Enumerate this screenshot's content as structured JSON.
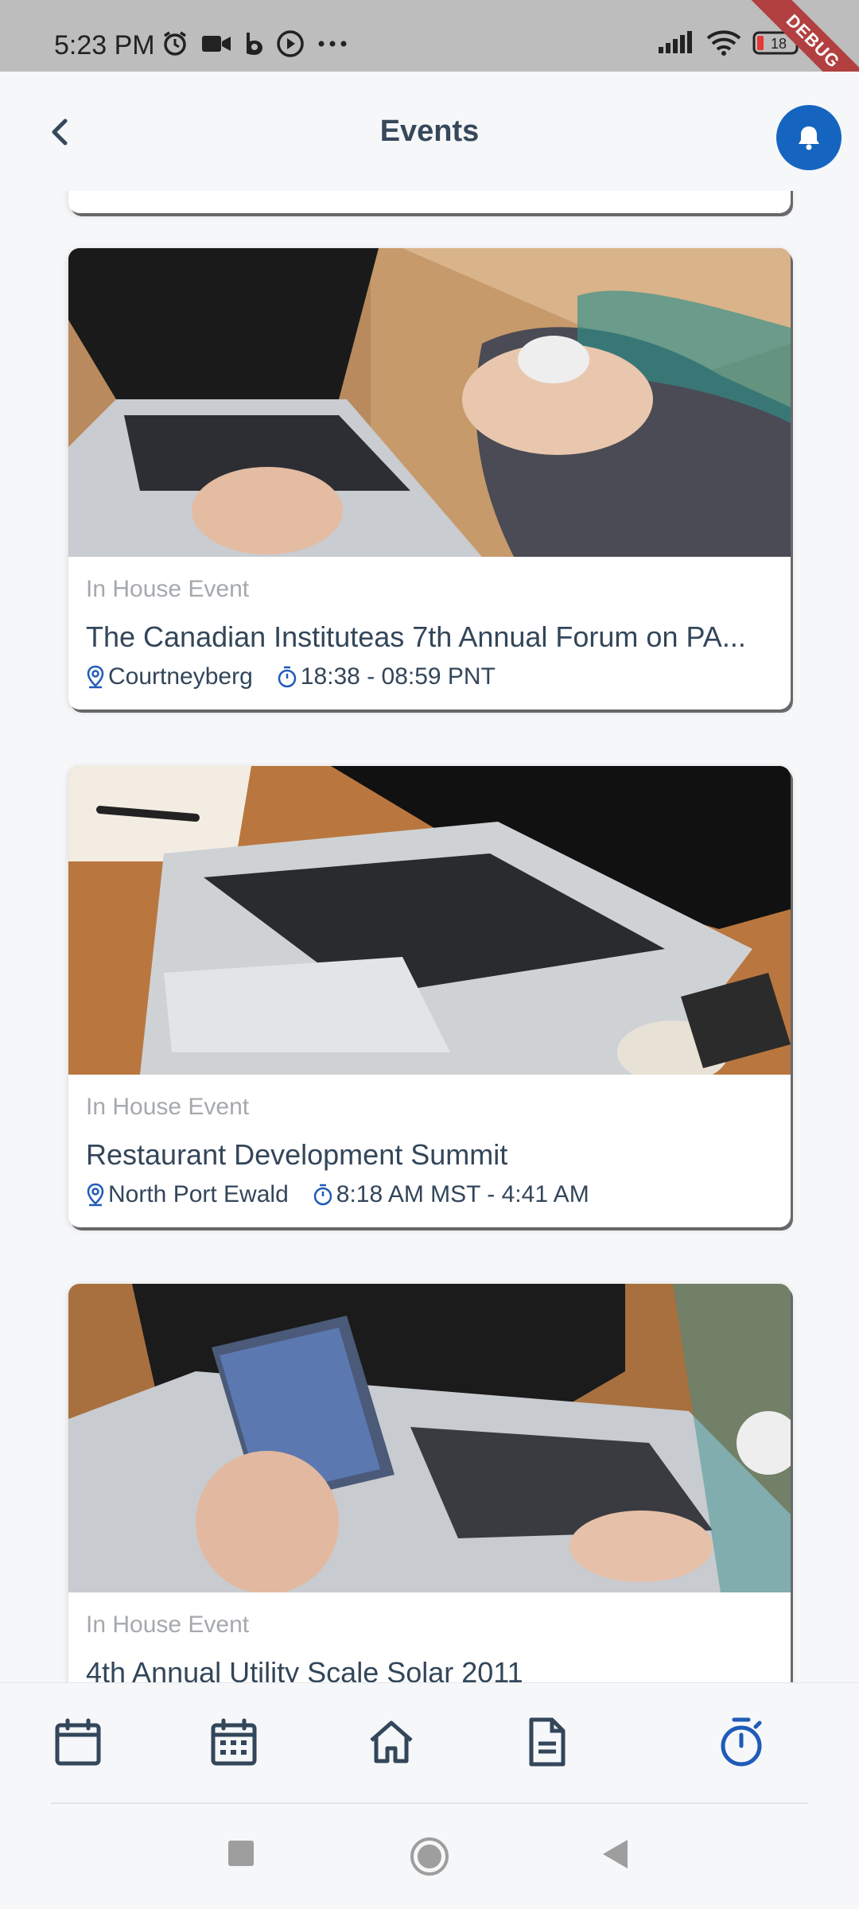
{
  "status_bar": {
    "time": "5:23 PM",
    "battery": "18",
    "left_icons": [
      "alarm-icon",
      "video-icon",
      "b-app-icon",
      "play-circle-icon",
      "more-dots-icon"
    ],
    "right_icons": [
      "signal-icon",
      "wifi-icon",
      "battery-icon"
    ]
  },
  "debug_banner": "DEBUG",
  "header": {
    "title": "Events",
    "back_icon": "chevron-left-icon",
    "notification_icon": "bell-icon",
    "accent": "#1565c0"
  },
  "events": [
    {
      "type": "In House Event",
      "title": "The Canadian Instituteas 7th Annual Forum on PA...",
      "location": "Courtneyberg",
      "time": "18:38  - 08:59 PNT",
      "image": "laptop-typing-photo"
    },
    {
      "type": "In House Event",
      "title": "Restaurant Development Summit",
      "location": "North Port Ewald",
      "time": "8:18 AM MST - 4:41 AM",
      "image": "laptop-desk-photo"
    },
    {
      "type": "In House Event",
      "title": "4th Annual Utility Scale Solar 2011",
      "image": "phone-laptop-photo"
    }
  ],
  "bottom_nav": {
    "items": [
      "calendar-icon",
      "calendar-grid-icon",
      "home-icon",
      "document-icon",
      "stopwatch-icon"
    ],
    "active": "stopwatch-icon",
    "active_color": "#1f5bb8",
    "inactive_color": "#33465a"
  },
  "system_nav": [
    "recents-square-icon",
    "home-circle-icon",
    "back-triangle-icon"
  ]
}
